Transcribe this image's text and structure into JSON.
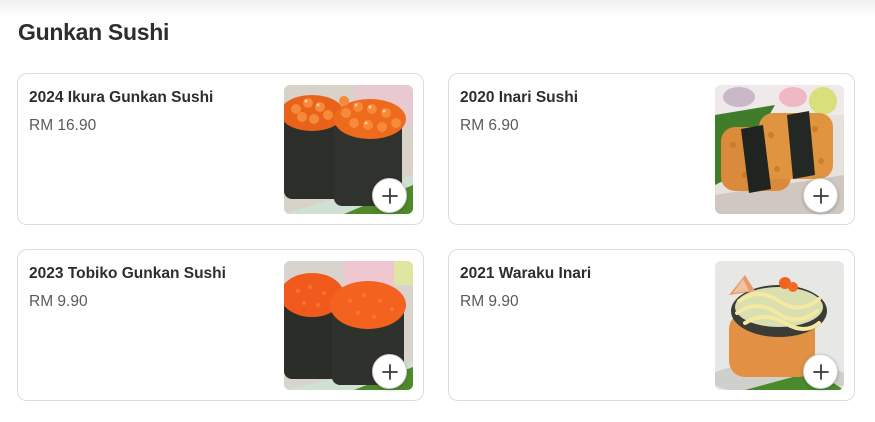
{
  "section": {
    "title": "Gunkan Sushi"
  },
  "items": [
    {
      "name": "2024 Ikura Gunkan Sushi",
      "price": "RM 16.90",
      "image": "ikura-gunkan-photo",
      "add_icon": "plus-icon"
    },
    {
      "name": "2020 Inari Sushi",
      "price": "RM 6.90",
      "image": "inari-sushi-photo",
      "add_icon": "plus-icon"
    },
    {
      "name": "2023 Tobiko Gunkan Sushi",
      "price": "RM 9.90",
      "image": "tobiko-gunkan-photo",
      "add_icon": "plus-icon"
    },
    {
      "name": "2021 Waraku Inari",
      "price": "RM 9.90",
      "image": "waraku-inari-photo",
      "add_icon": "plus-icon"
    }
  ],
  "colors": {
    "text": "#2d2d2d",
    "price": "#5a5a5a",
    "border": "#dcdcdc"
  }
}
